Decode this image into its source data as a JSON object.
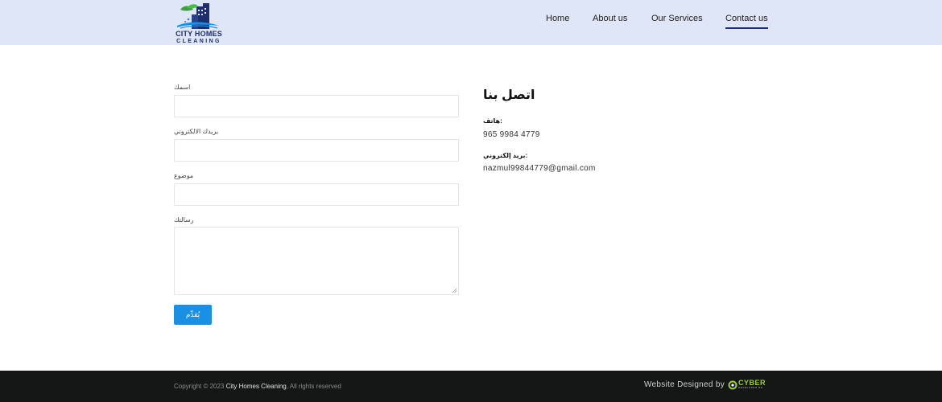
{
  "header": {
    "logo": {
      "line1": "CITY HOMES",
      "line2": "CLEANING"
    },
    "nav": [
      {
        "label": "Home",
        "active": false
      },
      {
        "label": "About us",
        "active": false
      },
      {
        "label": "Our Services",
        "active": false
      },
      {
        "label": "Contact us",
        "active": true
      }
    ]
  },
  "form": {
    "name_label": "اسمك",
    "email_label": "بريدك الالكتروني",
    "subject_label": "موضوع",
    "message_label": "رسالتك",
    "name_value": "",
    "email_value": "",
    "subject_value": "",
    "message_value": "",
    "submit_label": "يُقدِّم"
  },
  "contact": {
    "title": "اتصل بنا",
    "phone_label": "هاتف:",
    "phone_value": "965 9984 4779",
    "email_label": "بريد إلكتروني:",
    "email_value": "nazmul99844779@gmail.com"
  },
  "footer": {
    "copyright_prefix": "Copyright © 2023 ",
    "copyright_brand": "City Homes Cleaning",
    "copyright_suffix": ", All rights reserved",
    "designed_by": "Website Designed by",
    "designer_name": "CYBER",
    "designer_sub": "DEVELOPER BD"
  },
  "colors": {
    "header_bg": "#dfe6f7",
    "brand_navy": "#1e2d6b",
    "submit_blue": "#1a8fe3",
    "footer_bg": "#151716",
    "designer_green": "#9ccc3c"
  }
}
